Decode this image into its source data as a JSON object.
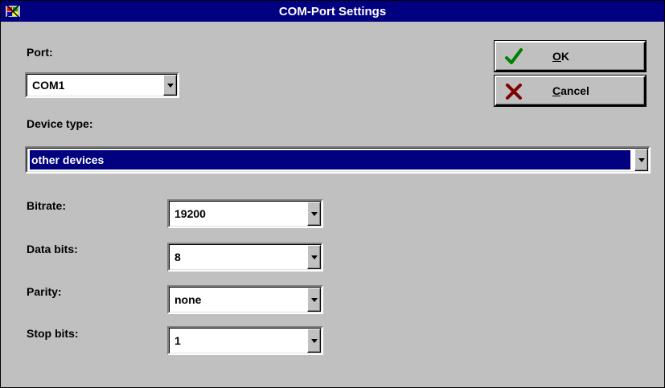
{
  "window": {
    "title": "COM-Port Settings",
    "icon": "com-port-app-icon"
  },
  "port": {
    "label": "Port:",
    "value": "COM1"
  },
  "device_type": {
    "label": "Device type:",
    "value": "other devices"
  },
  "bitrate": {
    "label": "Bitrate:",
    "value": "19200"
  },
  "data_bits": {
    "label": "Data bits:",
    "value": "8"
  },
  "parity": {
    "label": "Parity:",
    "value": "none"
  },
  "stop_bits": {
    "label": "Stop bits:",
    "value": "1"
  },
  "buttons": {
    "ok": {
      "accel": "O",
      "rest": "K",
      "icon": "checkmark-icon",
      "icon_color": "#008000"
    },
    "cancel": {
      "accel": "C",
      "rest": "ancel",
      "icon": "x-icon",
      "icon_color": "#800000"
    }
  },
  "colors": {
    "titlebar": "#000080",
    "face": "#c0c0c0",
    "selection": "#000080"
  }
}
